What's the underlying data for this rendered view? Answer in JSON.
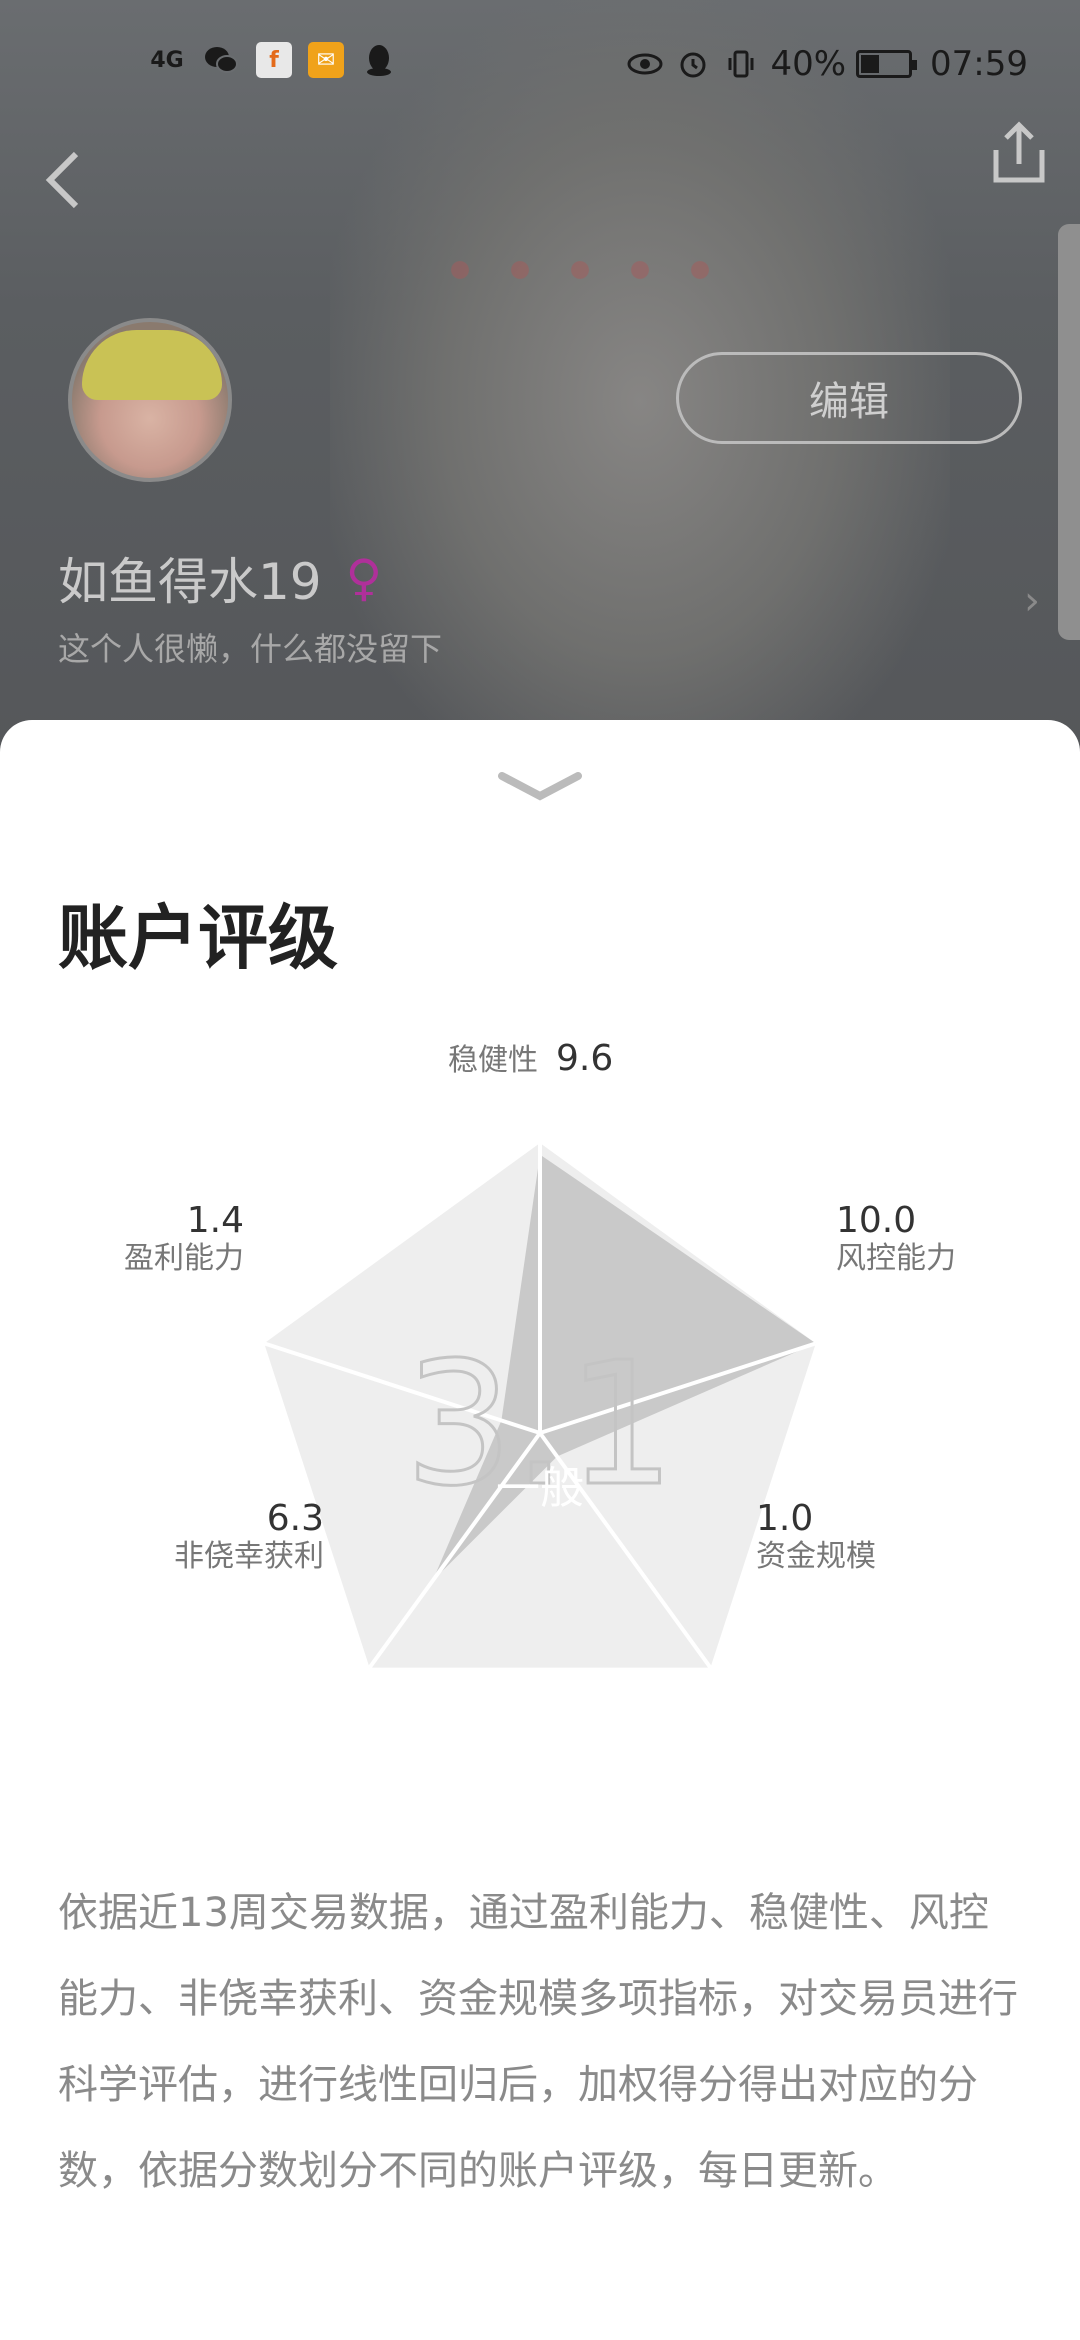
{
  "statusbar": {
    "network": "4G",
    "battery_pct": "40%",
    "battery_level": 0.4,
    "time": "07:59",
    "icons_left": [
      "signal-icon",
      "wechat-icon",
      "app-icon",
      "mail-icon",
      "qq-icon"
    ],
    "icons_right": [
      "eye-icon",
      "alarm-icon",
      "vibrate-icon",
      "battery-icon"
    ]
  },
  "profile": {
    "edit_label": "编辑",
    "username": "如鱼得水19",
    "gender_symbol": "♀",
    "bio": "这个人很懒，什么都没留下"
  },
  "sheet": {
    "title": "账户评级"
  },
  "chart_data": {
    "type": "radar",
    "score": "3.1",
    "grade": "一般",
    "axes": [
      {
        "label": "稳健性",
        "value": 9.6,
        "value_text": "9.6"
      },
      {
        "label": "风控能力",
        "value": 10.0,
        "value_text": "10.0"
      },
      {
        "label": "资金规模",
        "value": 1.0,
        "value_text": "1.0"
      },
      {
        "label": "非侥幸获利",
        "value": 6.3,
        "value_text": "6.3"
      },
      {
        "label": "盈利能力",
        "value": 1.4,
        "value_text": "1.4"
      }
    ],
    "max": 10,
    "colors": {
      "background": "#eeeeee",
      "fill": "#c9c9c9",
      "spokes": "#ffffff",
      "score": "#c4c4c4"
    }
  },
  "description": "依据近13周交易数据，通过盈利能力、稳健性、风控能力、非侥幸获利、资金规模多项指标，对交易员进行科学评估，进行线性回归后，加权得分得出对应的分数，依据分数划分不同的账户评级，每日更新。"
}
